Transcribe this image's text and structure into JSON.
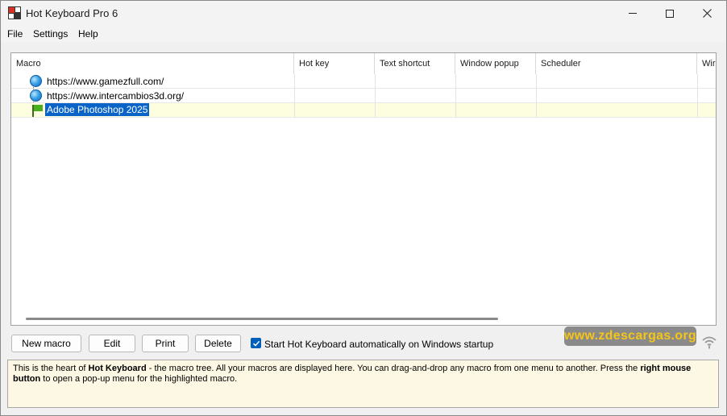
{
  "window": {
    "title": "Hot Keyboard Pro 6",
    "app_icon": "hot-keyboard-app-icon",
    "controls": [
      "minimize-icon",
      "maximize-icon",
      "close-icon"
    ]
  },
  "menu": {
    "items": [
      {
        "label": "File"
      },
      {
        "label": "Settings"
      },
      {
        "label": "Help"
      }
    ]
  },
  "table": {
    "columns": [
      {
        "label": "Macro"
      },
      {
        "label": "Hot key"
      },
      {
        "label": "Text shortcut"
      },
      {
        "label": "Window popup"
      },
      {
        "label": "Scheduler"
      },
      {
        "label": "Wir"
      }
    ],
    "rows": [
      {
        "label": "https://www.gamezfull.com/",
        "icon": "globe-icon",
        "selected": false
      },
      {
        "label": "https://www.intercambios3d.org/",
        "icon": "globe-icon",
        "selected": false
      },
      {
        "label": "Adobe Photoshop 2025",
        "icon": "flag-icon",
        "selected": true
      }
    ]
  },
  "buttons": {
    "new_macro": "New macro",
    "edit": "Edit",
    "print": "Print",
    "delete": "Delete"
  },
  "startup": {
    "checked": true,
    "label": "Start Hot Keyboard automatically on Windows startup"
  },
  "watermark": "www.zdescargas.org",
  "help": {
    "part1": "This is the heart of ",
    "bold1": "Hot Keyboard",
    "part2": " - the macro tree. All your macros are displayed here. You can drag-and-drop any macro from one menu to another. Press the ",
    "bold2": "right mouse button",
    "part3": " to open a pop-up menu for the highlighted macro."
  },
  "colors": {
    "selection": "#0a64c8",
    "selected_row": "#fdfde0",
    "help_background": "#fdf8e4",
    "watermark_text": "#f5c518",
    "checkbox": "#005fb8"
  }
}
